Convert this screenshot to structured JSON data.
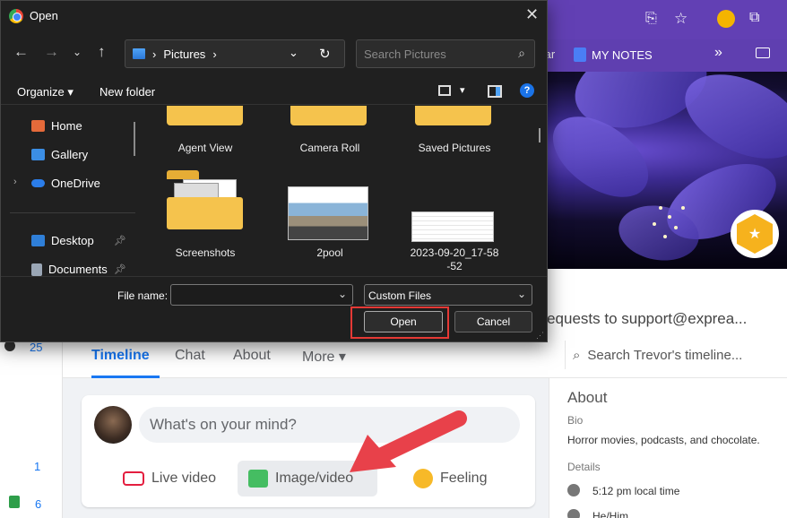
{
  "dialog": {
    "title": "Open",
    "address": {
      "segment": "Pictures",
      "sep1": "›",
      "sep2": "›"
    },
    "search_placeholder": "Search Pictures",
    "commands": {
      "organize": "Organize ▾",
      "new_folder": "New folder"
    },
    "sidebar": [
      {
        "label": "Home",
        "icon": "home-icon",
        "color": "#e56a3a"
      },
      {
        "label": "Gallery",
        "icon": "gallery-icon",
        "color": "#3b8ee5"
      },
      {
        "label": "OneDrive",
        "icon": "onedrive-icon",
        "color": "#2b7de9"
      },
      {
        "label": "Desktop",
        "icon": "desktop-icon",
        "color": "#2f7fd8"
      },
      {
        "label": "Documents",
        "icon": "documents-icon",
        "color": "#9aa6b5"
      }
    ],
    "files": [
      {
        "label": "Agent View",
        "kind": "folder"
      },
      {
        "label": "Camera Roll",
        "kind": "folder"
      },
      {
        "label": "Saved Pictures",
        "kind": "folder"
      },
      {
        "label": "Screenshots",
        "kind": "folder"
      },
      {
        "label": "2pool",
        "kind": "image"
      },
      {
        "label": "2023-09-20_17-58\n-52",
        "kind": "image"
      }
    ],
    "file_name_label": "File name:",
    "file_name_value": "",
    "file_type": "Custom Files",
    "open_label": "Open",
    "cancel_label": "Cancel"
  },
  "browser": {
    "bookmarks": [
      "tar",
      "MY NOTES",
      "»"
    ]
  },
  "profile": {
    "support_text": "t requests to support@exprea...",
    "tabs": [
      "Timeline",
      "Chat",
      "About",
      "More ▾"
    ],
    "timeline_search_placeholder": "Search Trevor's timeline...",
    "rail_numbers": [
      "25",
      "1",
      "6"
    ],
    "composer": {
      "placeholder": "What's on your mind?",
      "actions": [
        "Live video",
        "Image/video",
        "Feeling"
      ]
    },
    "about": {
      "title": "About",
      "bio_label": "Bio",
      "bio": "Horror movies, podcasts, and chocolate.",
      "details_label": "Details",
      "local_time": "5:12 pm local time",
      "pronoun": "He/Him"
    }
  },
  "colors": {
    "accent": "#1877f2",
    "highlight": "#e53935",
    "arrow": "#e8414a",
    "badge": "#f6b21d"
  }
}
